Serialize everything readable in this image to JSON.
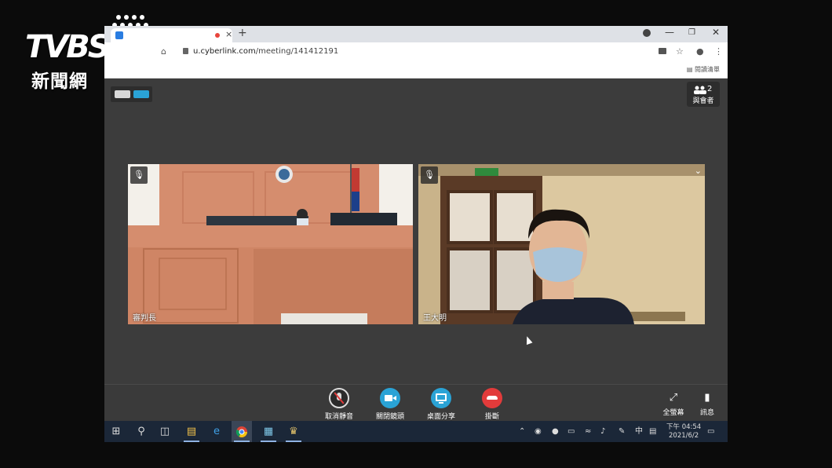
{
  "browser": {
    "url_host": "u.cyberlink.com",
    "url_path": "/meeting/141412191",
    "tab_close": "×",
    "new_tab": "+",
    "reading_list": "閱讀清單"
  },
  "meeting": {
    "participants_count": "2",
    "participants_label": "與會者",
    "tiles": [
      {
        "name": "審判長"
      },
      {
        "name": "王大明"
      }
    ]
  },
  "controls": {
    "mute_label": "取消靜音",
    "camera_label": "關閉鏡頭",
    "share_label": "桌面分享",
    "hangup_label": "掛斷",
    "fullscreen_label": "全螢幕",
    "chat_label": "訊息"
  },
  "taskbar": {
    "time": "下午 04:54",
    "date": "2021/6/2",
    "ime": "中"
  },
  "logo": {
    "main": "TVBS",
    "sub": "新聞網"
  },
  "colors": {
    "accent_blue": "#2aa3d6",
    "hangup_red": "#e23b3b",
    "taskbar": "#1b2738"
  }
}
